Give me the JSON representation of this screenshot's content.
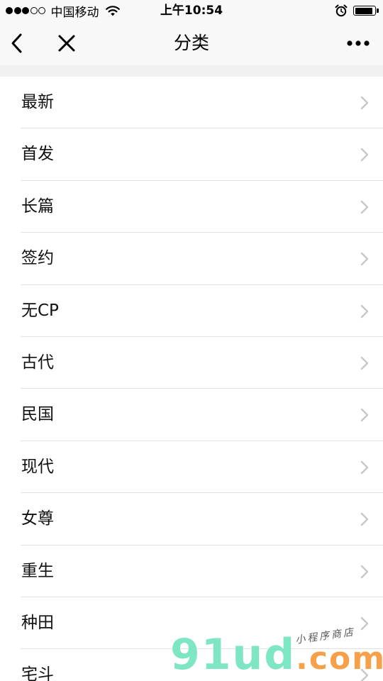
{
  "status_bar": {
    "carrier": "中国移动",
    "time": "上午10:54",
    "signal_filled": 3,
    "signal_total": 5,
    "battery_level": 0.9
  },
  "nav": {
    "title": "分类",
    "back_icon": "chevron-left-icon",
    "close_icon": "close-icon",
    "more_icon": "more-horizontal-icon"
  },
  "categories": [
    {
      "label": "最新"
    },
    {
      "label": "首发"
    },
    {
      "label": "长篇"
    },
    {
      "label": "签约"
    },
    {
      "label": "无CP"
    },
    {
      "label": "古代"
    },
    {
      "label": "民国"
    },
    {
      "label": "现代"
    },
    {
      "label": "女尊"
    },
    {
      "label": "重生"
    },
    {
      "label": "种田"
    },
    {
      "label": "宅斗"
    }
  ],
  "watermark": {
    "main": "91ud",
    "suffix": ".com",
    "sub": "小程序商店"
  },
  "colors": {
    "nav_background": "#f8f8f8",
    "separator": "#e2e2e2",
    "chevron": "#c7c7cc",
    "watermark_green": "#7fe6c4",
    "watermark_orange": "#f6a14a"
  }
}
